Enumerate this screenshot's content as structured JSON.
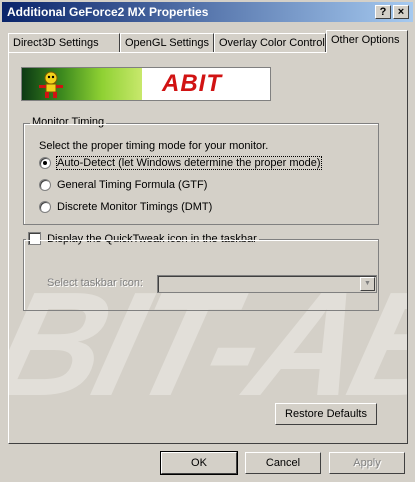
{
  "window": {
    "title": "Additional GeForce2 MX Properties"
  },
  "titlebar": {
    "help_label": "?",
    "close_label": "×"
  },
  "tabs": [
    {
      "label": "Direct3D Settings"
    },
    {
      "label": "OpenGL Settings"
    },
    {
      "label": "Overlay Color Control"
    },
    {
      "label": "Other Options"
    }
  ],
  "active_tab": "Other Options",
  "banner": {
    "logo_text": "ABIT"
  },
  "monitor_timing": {
    "group_label": "Monitor Timing",
    "description": "Select the proper timing mode for your monitor.",
    "options": [
      {
        "label": "Auto-Detect (let Windows determine the proper mode)",
        "checked": true
      },
      {
        "label": "General Timing Formula (GTF)",
        "checked": false
      },
      {
        "label": "Discrete Monitor Timings (DMT)",
        "checked": false
      }
    ]
  },
  "quicktweak": {
    "checkbox_label": "Display the QuickTweak icon in the taskbar",
    "checked": false,
    "select_label": "Select taskbar icon:",
    "select_value": ""
  },
  "watermark_text": "BIT-AB",
  "restore_defaults_label": "Restore Defaults",
  "footer": {
    "ok_label": "OK",
    "cancel_label": "Cancel",
    "apply_label": "Apply"
  }
}
